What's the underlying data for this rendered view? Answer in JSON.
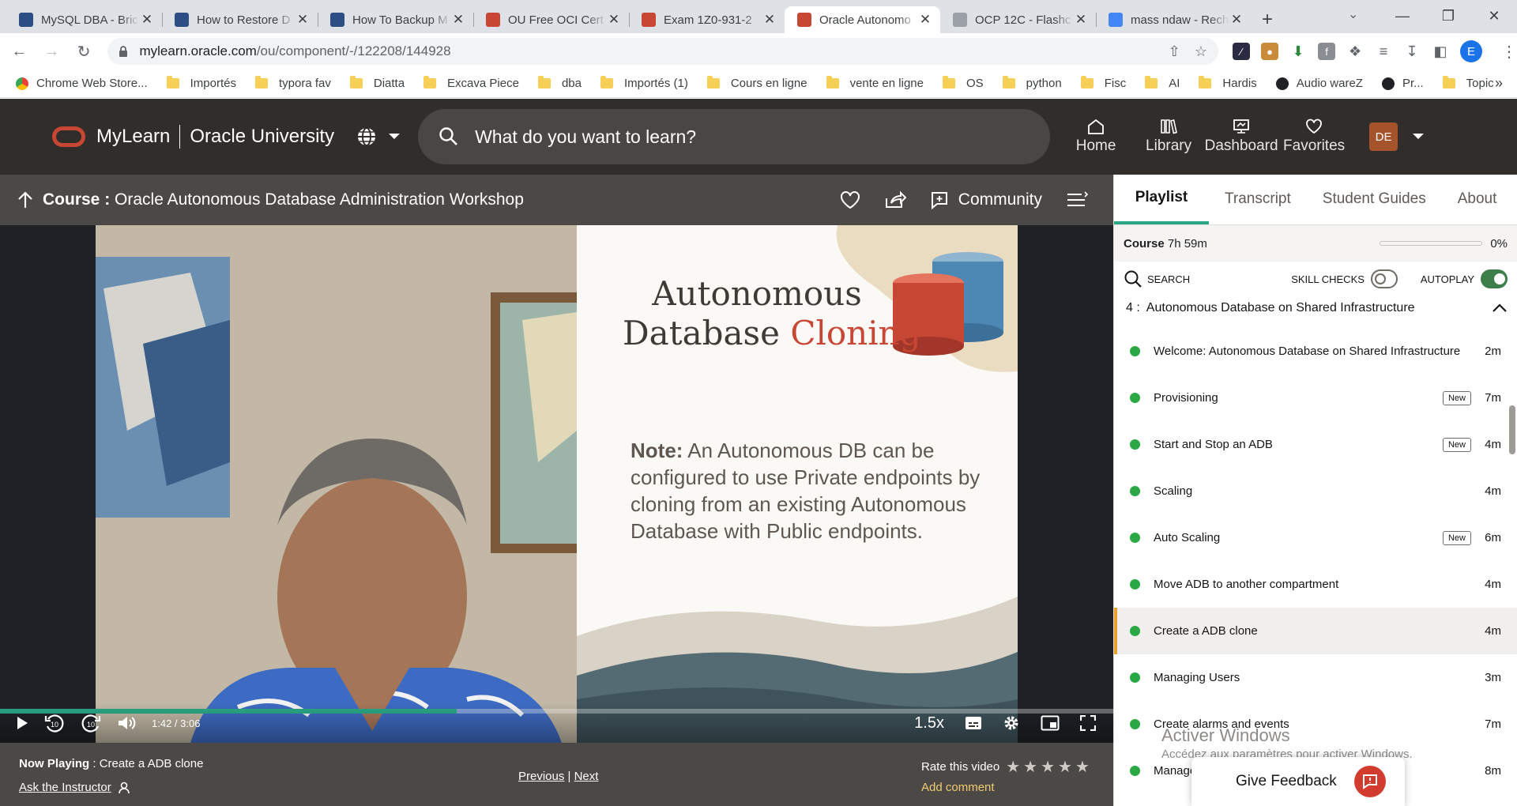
{
  "browser": {
    "tabs": [
      {
        "title": "MySQL DBA - Bric",
        "color": "#2c4e85"
      },
      {
        "title": "How to Restore D",
        "color": "#2c4e85"
      },
      {
        "title": "How To Backup M",
        "color": "#2c4e85"
      },
      {
        "title": "OU Free OCI Cert",
        "color": "#c74634"
      },
      {
        "title": "Exam 1Z0-931-2",
        "color": "#c74634"
      },
      {
        "title": "Oracle Autonomo",
        "color": "#c74634"
      },
      {
        "title": "OCP 12C - Flashc",
        "color": "#9aa0a6"
      },
      {
        "title": "mass ndaw - Rech",
        "color": "#4285f4"
      }
    ],
    "url_host": "mylearn.oracle.com",
    "url_path": "/ou/component/-/122208/144928",
    "profile_initial": "E",
    "bookmarks": [
      {
        "label": "Chrome Web Store...",
        "type": "app"
      },
      {
        "label": "Importés",
        "type": "folder"
      },
      {
        "label": "typora fav",
        "type": "folder"
      },
      {
        "label": "Diatta",
        "type": "folder"
      },
      {
        "label": "Excava Piece",
        "type": "folder"
      },
      {
        "label": "dba",
        "type": "folder"
      },
      {
        "label": "Importés (1)",
        "type": "folder"
      },
      {
        "label": "Cours en ligne",
        "type": "folder"
      },
      {
        "label": "vente en ligne",
        "type": "folder"
      },
      {
        "label": "OS",
        "type": "folder"
      },
      {
        "label": "python",
        "type": "folder"
      },
      {
        "label": "Fisc",
        "type": "folder"
      },
      {
        "label": "AI",
        "type": "folder"
      },
      {
        "label": "Hardis",
        "type": "folder"
      },
      {
        "label": "Audio wareZ",
        "type": "site"
      },
      {
        "label": "Pr...",
        "type": "site"
      },
      {
        "label": "Topic",
        "type": "folder"
      }
    ]
  },
  "header": {
    "brand": "MyLearn",
    "brand2": "Oracle University",
    "search_placeholder": "What do you want to learn?",
    "nav": [
      {
        "label": "Home",
        "icon": "home-icon"
      },
      {
        "label": "Library",
        "icon": "library-icon"
      },
      {
        "label": "Dashboard",
        "icon": "dashboard-icon"
      },
      {
        "label": "Favorites",
        "icon": "heart-icon"
      }
    ],
    "avatar": "DE"
  },
  "course": {
    "label": "Course",
    "sep": " : ",
    "title": "Oracle Autonomous Database Administration Workshop",
    "community": "Community"
  },
  "video": {
    "slide_title_1": "Autonomous",
    "slide_title_2": "Database ",
    "slide_title_accent": "Cloning",
    "note_label": "Note:",
    "note_text": " An Autonomous DB can be configured to use Private endpoints by cloning from an existing Autonomous Database with Public endpoints.",
    "current_time": "1:42",
    "total_time": "3:06",
    "progress": 0.41,
    "speed": "1.5x",
    "accent": "#2aa886"
  },
  "player_footer": {
    "now_playing_label": "Now Playing",
    "now_playing_sep": " : ",
    "now_playing": "Create a ADB clone",
    "ask": "Ask the Instructor",
    "previous": "Previous",
    "divider": " | ",
    "next": "Next",
    "rate": "Rate this video",
    "add_comment": "Add comment",
    "rating": 0
  },
  "panel": {
    "tabs": [
      "Playlist",
      "Transcript",
      "Student Guides",
      "About"
    ],
    "course_label": "Course",
    "course_duration": "7h 59m",
    "progress_pct": "0%",
    "search": "SEARCH",
    "skill_checks": "SKILL CHECKS",
    "autoplay": "AUTOPLAY",
    "module": "4 :  Autonomous Database on Shared Infrastructure",
    "new_badge": "New",
    "lessons": [
      {
        "name": "Welcome: Autonomous Database on Shared Infrastructure",
        "dur": "2m",
        "new": false
      },
      {
        "name": "Provisioning",
        "dur": "7m",
        "new": true
      },
      {
        "name": "Start and Stop an ADB",
        "dur": "4m",
        "new": true
      },
      {
        "name": "Scaling",
        "dur": "4m",
        "new": false
      },
      {
        "name": "Auto Scaling",
        "dur": "6m",
        "new": true
      },
      {
        "name": "Move ADB to another compartment",
        "dur": "4m",
        "new": false
      },
      {
        "name": "Create a ADB clone",
        "dur": "4m",
        "new": false,
        "current": true
      },
      {
        "name": "Managing Users",
        "dur": "3m",
        "new": false
      },
      {
        "name": "Create alarms and events",
        "dur": "7m",
        "new": false
      },
      {
        "name": "Manage",
        "dur": "8m",
        "new": false
      }
    ]
  },
  "overlay": {
    "watermark_title": "Activer Windows",
    "watermark_sub": "Accédez aux paramètres pour activer Windows.",
    "feedback": "Give Feedback"
  }
}
